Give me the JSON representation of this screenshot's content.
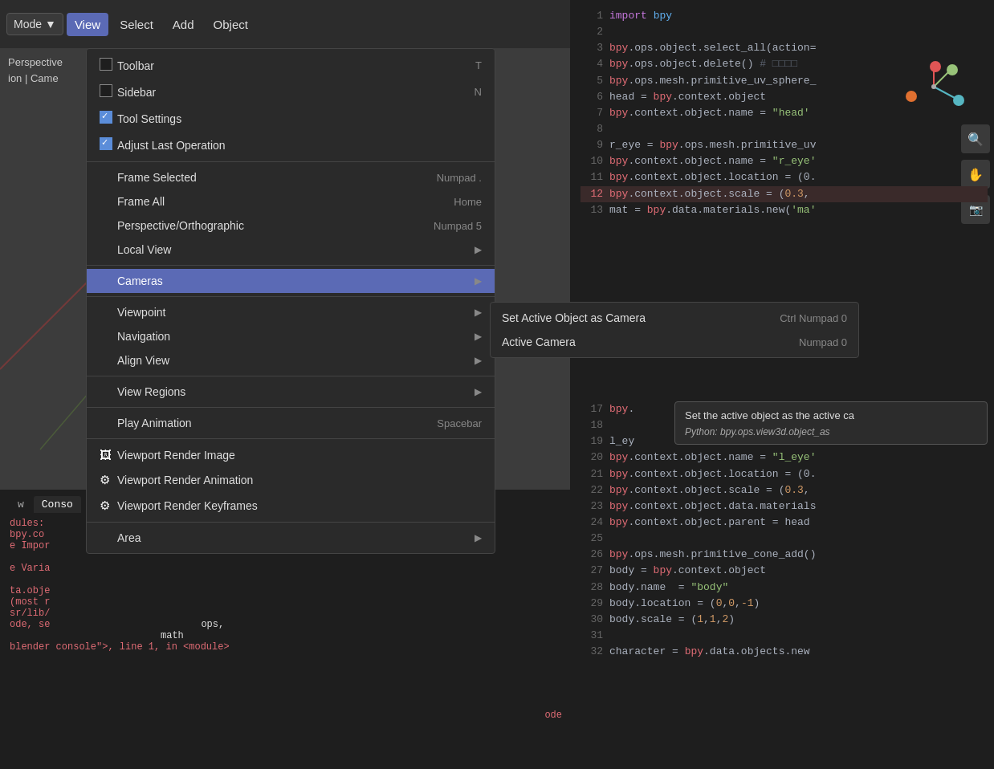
{
  "topbar": {
    "mode_label": "Mode",
    "menu_items": [
      "View",
      "Select",
      "Add",
      "Object"
    ]
  },
  "viewport": {
    "label1": "Perspective",
    "label2": "ion | Came"
  },
  "view_menu": {
    "items": [
      {
        "id": "toolbar",
        "label": "Toolbar",
        "shortcut": "T",
        "checked": false,
        "type": "checkbox"
      },
      {
        "id": "sidebar",
        "label": "Sidebar",
        "shortcut": "N",
        "checked": false,
        "type": "checkbox"
      },
      {
        "id": "tool_settings",
        "label": "Tool Settings",
        "shortcut": "",
        "checked": true,
        "type": "checkbox"
      },
      {
        "id": "adjust_last",
        "label": "Adjust Last Operation",
        "shortcut": "",
        "checked": true,
        "type": "checkbox"
      },
      {
        "id": "divider1",
        "type": "divider"
      },
      {
        "id": "frame_selected",
        "label": "Frame Selected",
        "shortcut": "Numpad .",
        "type": "item"
      },
      {
        "id": "frame_all",
        "label": "Frame All",
        "shortcut": "Home",
        "type": "item"
      },
      {
        "id": "perspective",
        "label": "Perspective/Orthographic",
        "shortcut": "Numpad 5",
        "type": "item"
      },
      {
        "id": "local_view",
        "label": "Local View",
        "shortcut": "",
        "type": "submenu"
      },
      {
        "id": "divider2",
        "type": "divider"
      },
      {
        "id": "cameras",
        "label": "Cameras",
        "shortcut": "",
        "type": "submenu",
        "active": true
      },
      {
        "id": "divider3",
        "type": "divider"
      },
      {
        "id": "viewpoint",
        "label": "Viewpoint",
        "shortcut": "",
        "type": "submenu"
      },
      {
        "id": "navigation",
        "label": "Navigation",
        "shortcut": "",
        "type": "submenu"
      },
      {
        "id": "align_view",
        "label": "Align View",
        "shortcut": "",
        "type": "submenu"
      },
      {
        "id": "divider4",
        "type": "divider"
      },
      {
        "id": "view_regions",
        "label": "View Regions",
        "shortcut": "",
        "type": "submenu"
      },
      {
        "id": "divider5",
        "type": "divider"
      },
      {
        "id": "play_animation",
        "label": "Play Animation",
        "shortcut": "Spacebar",
        "type": "item"
      },
      {
        "id": "divider6",
        "type": "divider"
      },
      {
        "id": "viewport_render_image",
        "label": "Viewport Render Image",
        "shortcut": "",
        "type": "icon-item",
        "icon": "🖼"
      },
      {
        "id": "viewport_render_animation",
        "label": "Viewport Render Animation",
        "shortcut": "",
        "type": "icon-item",
        "icon": "🎬"
      },
      {
        "id": "viewport_render_keyframes",
        "label": "Viewport Render Keyframes",
        "shortcut": "",
        "type": "icon-item",
        "icon": "🎬"
      },
      {
        "id": "divider7",
        "type": "divider"
      },
      {
        "id": "area",
        "label": "Area",
        "shortcut": "",
        "type": "submenu"
      }
    ]
  },
  "cameras_submenu": {
    "items": [
      {
        "id": "set_active",
        "label": "Set Active Object as Camera",
        "shortcut": "Ctrl Numpad 0"
      },
      {
        "id": "active_camera",
        "label": "Active Camera",
        "shortcut": "Numpad 0"
      }
    ]
  },
  "tooltip": {
    "description": "Set the active object as the active ca",
    "python": "Python: bpy.ops.view3d.object_as"
  },
  "code_editor": {
    "lines": [
      {
        "num": "1",
        "content": "import bpy"
      },
      {
        "num": "2",
        "content": ""
      },
      {
        "num": "3",
        "content": "bpy.ops.object.select_all(action="
      },
      {
        "num": "4",
        "content": "bpy.ops.object.delete() # □□□□"
      },
      {
        "num": "5",
        "content": "bpy.ops.mesh.primitive_uv_sphere_"
      },
      {
        "num": "6",
        "content": "head = bpy.context.object"
      },
      {
        "num": "7",
        "content": "bpy.context.object.name = \"head'"
      },
      {
        "num": "8",
        "content": ""
      },
      {
        "num": "9",
        "content": "r_eye = bpy.ops.mesh.primitive_uv"
      },
      {
        "num": "10",
        "content": "bpy.context.object.name = \"r_eye'"
      },
      {
        "num": "11",
        "content": "bpy.context.object.location = (0."
      },
      {
        "num": "12",
        "content": "bpy.context.object.scale = (0.3,",
        "highlight": true
      },
      {
        "num": "13",
        "content": "mat = bpy.data.materials.new('ma'"
      }
    ]
  },
  "bottom_code": {
    "lines": [
      {
        "num": "17",
        "content": "bpy."
      },
      {
        "num": "18",
        "content": ""
      },
      {
        "num": "19",
        "content": "l_ey"
      },
      {
        "num": "20",
        "content": "bpy.context.object.name = \"l_eye'"
      },
      {
        "num": "21",
        "content": "bpy.context.object.location = (0."
      },
      {
        "num": "22",
        "content": "bpy.context.object.scale = (0.3,"
      },
      {
        "num": "23",
        "content": "bpy.context.object.data.materials"
      },
      {
        "num": "24",
        "content": "bpy.context.object.parent = head"
      },
      {
        "num": "25",
        "content": ""
      },
      {
        "num": "26",
        "content": "bpy.ops.mesh.primitive_cone_add()"
      },
      {
        "num": "27",
        "content": "body = bpy.context.object"
      },
      {
        "num": "28",
        "content": "body.name  = \"body\""
      },
      {
        "num": "29",
        "content": "body.location = (0,0,-1)"
      },
      {
        "num": "30",
        "content": "body.scale = (1,1,2)"
      },
      {
        "num": "31",
        "content": ""
      },
      {
        "num": "32",
        "content": "character = bpy.data.objects.new"
      }
    ]
  },
  "console": {
    "tabs": [
      "w",
      "Conso"
    ],
    "lines": [
      "dules:",
      "bpy.co",
      "e Impor",
      "",
      "e Varia",
      "",
      "ta.obje",
      "(most r",
      "sr/lib/",
      "ode, se",
      "blender console\", line 1, in <module>"
    ],
    "partial_text": "ops,",
    "math_text": "math",
    "code_text": "ode"
  },
  "colors": {
    "menu_bg": "#2a2a2a",
    "active_highlight": "#5b6ab5",
    "text_primary": "#e0e0e0",
    "text_secondary": "#888888",
    "keyword": "#c678dd",
    "function": "#61afef",
    "string": "#98c379",
    "number": "#d19a66",
    "error": "#e06c75"
  }
}
